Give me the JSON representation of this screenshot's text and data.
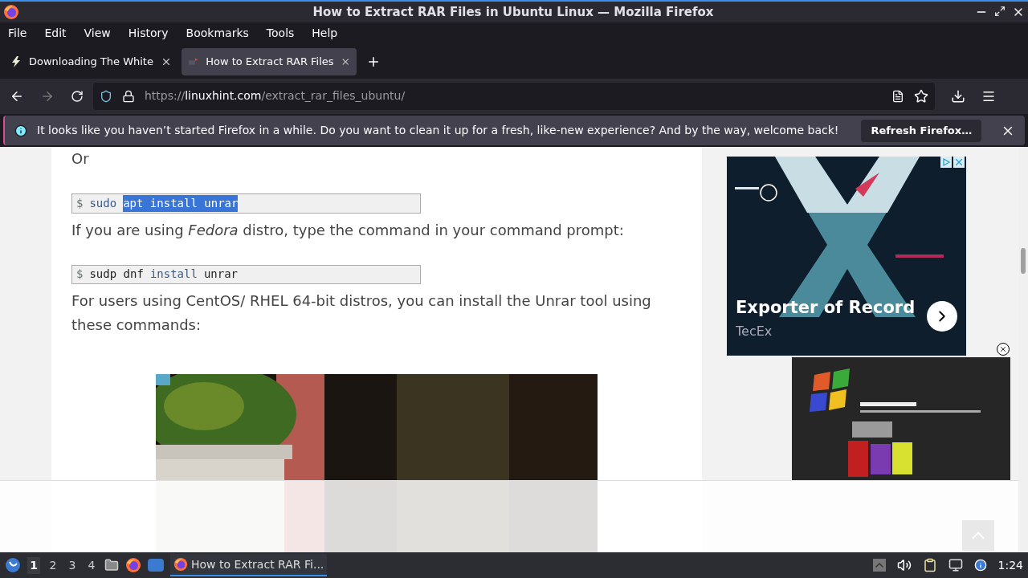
{
  "window": {
    "title": "How to Extract RAR Files in Ubuntu Linux — Mozilla Firefox"
  },
  "menu": [
    "File",
    "Edit",
    "View",
    "History",
    "Bookmarks",
    "Tools",
    "Help"
  ],
  "tabs": [
    {
      "label": "Downloading The White",
      "selected": false
    },
    {
      "label": "How to Extract RAR Files",
      "selected": true
    }
  ],
  "url": {
    "scheme": "https://",
    "domain": "linuxhint.com",
    "path": "/extract_rar_files_ubuntu/"
  },
  "notification": {
    "text": "It looks like you haven’t started Firefox in a while. Do you want to clean it up for a fresh, like-new experience? And by the way, welcome back!",
    "button": "Refresh Firefox…"
  },
  "article": [
    {
      "kind": "text",
      "text": "Or"
    },
    {
      "kind": "code",
      "tokens": [
        {
          "text": "$",
          "kind": "prompt",
          "selected": false
        },
        {
          "text": "sudo",
          "kind": "keyword",
          "selected": false
        },
        {
          "text": "apt install unrar",
          "kind": "keyword",
          "selected": true
        }
      ]
    },
    {
      "kind": "text",
      "text": "If you are using *Fedora* distro, type the command in your command prompt:"
    },
    {
      "kind": "code",
      "tokens": [
        {
          "text": "$",
          "kind": "prompt",
          "selected": false
        },
        {
          "text": "sudp dnf",
          "kind": "plain",
          "selected": false
        },
        {
          "text": "install",
          "kind": "keyword",
          "selected": false
        },
        {
          "text": "unrar",
          "kind": "plain",
          "selected": false
        }
      ]
    },
    {
      "kind": "text",
      "text": "For users using CentOS/ RHEL 64-bit distros, you can install the Unrar tool using these commands:"
    },
    {
      "kind": "video"
    }
  ],
  "ads": [
    {
      "headline": "Exporter of Record",
      "sponsor": "TecEx"
    }
  ],
  "taskbar": {
    "workspaces": [
      {
        "label": "1",
        "selected": true
      },
      {
        "label": "2",
        "selected": false
      },
      {
        "label": "3",
        "selected": false
      },
      {
        "label": "4",
        "selected": false
      }
    ],
    "task": "How to Extract RAR Fi...",
    "clock": "1:24"
  }
}
